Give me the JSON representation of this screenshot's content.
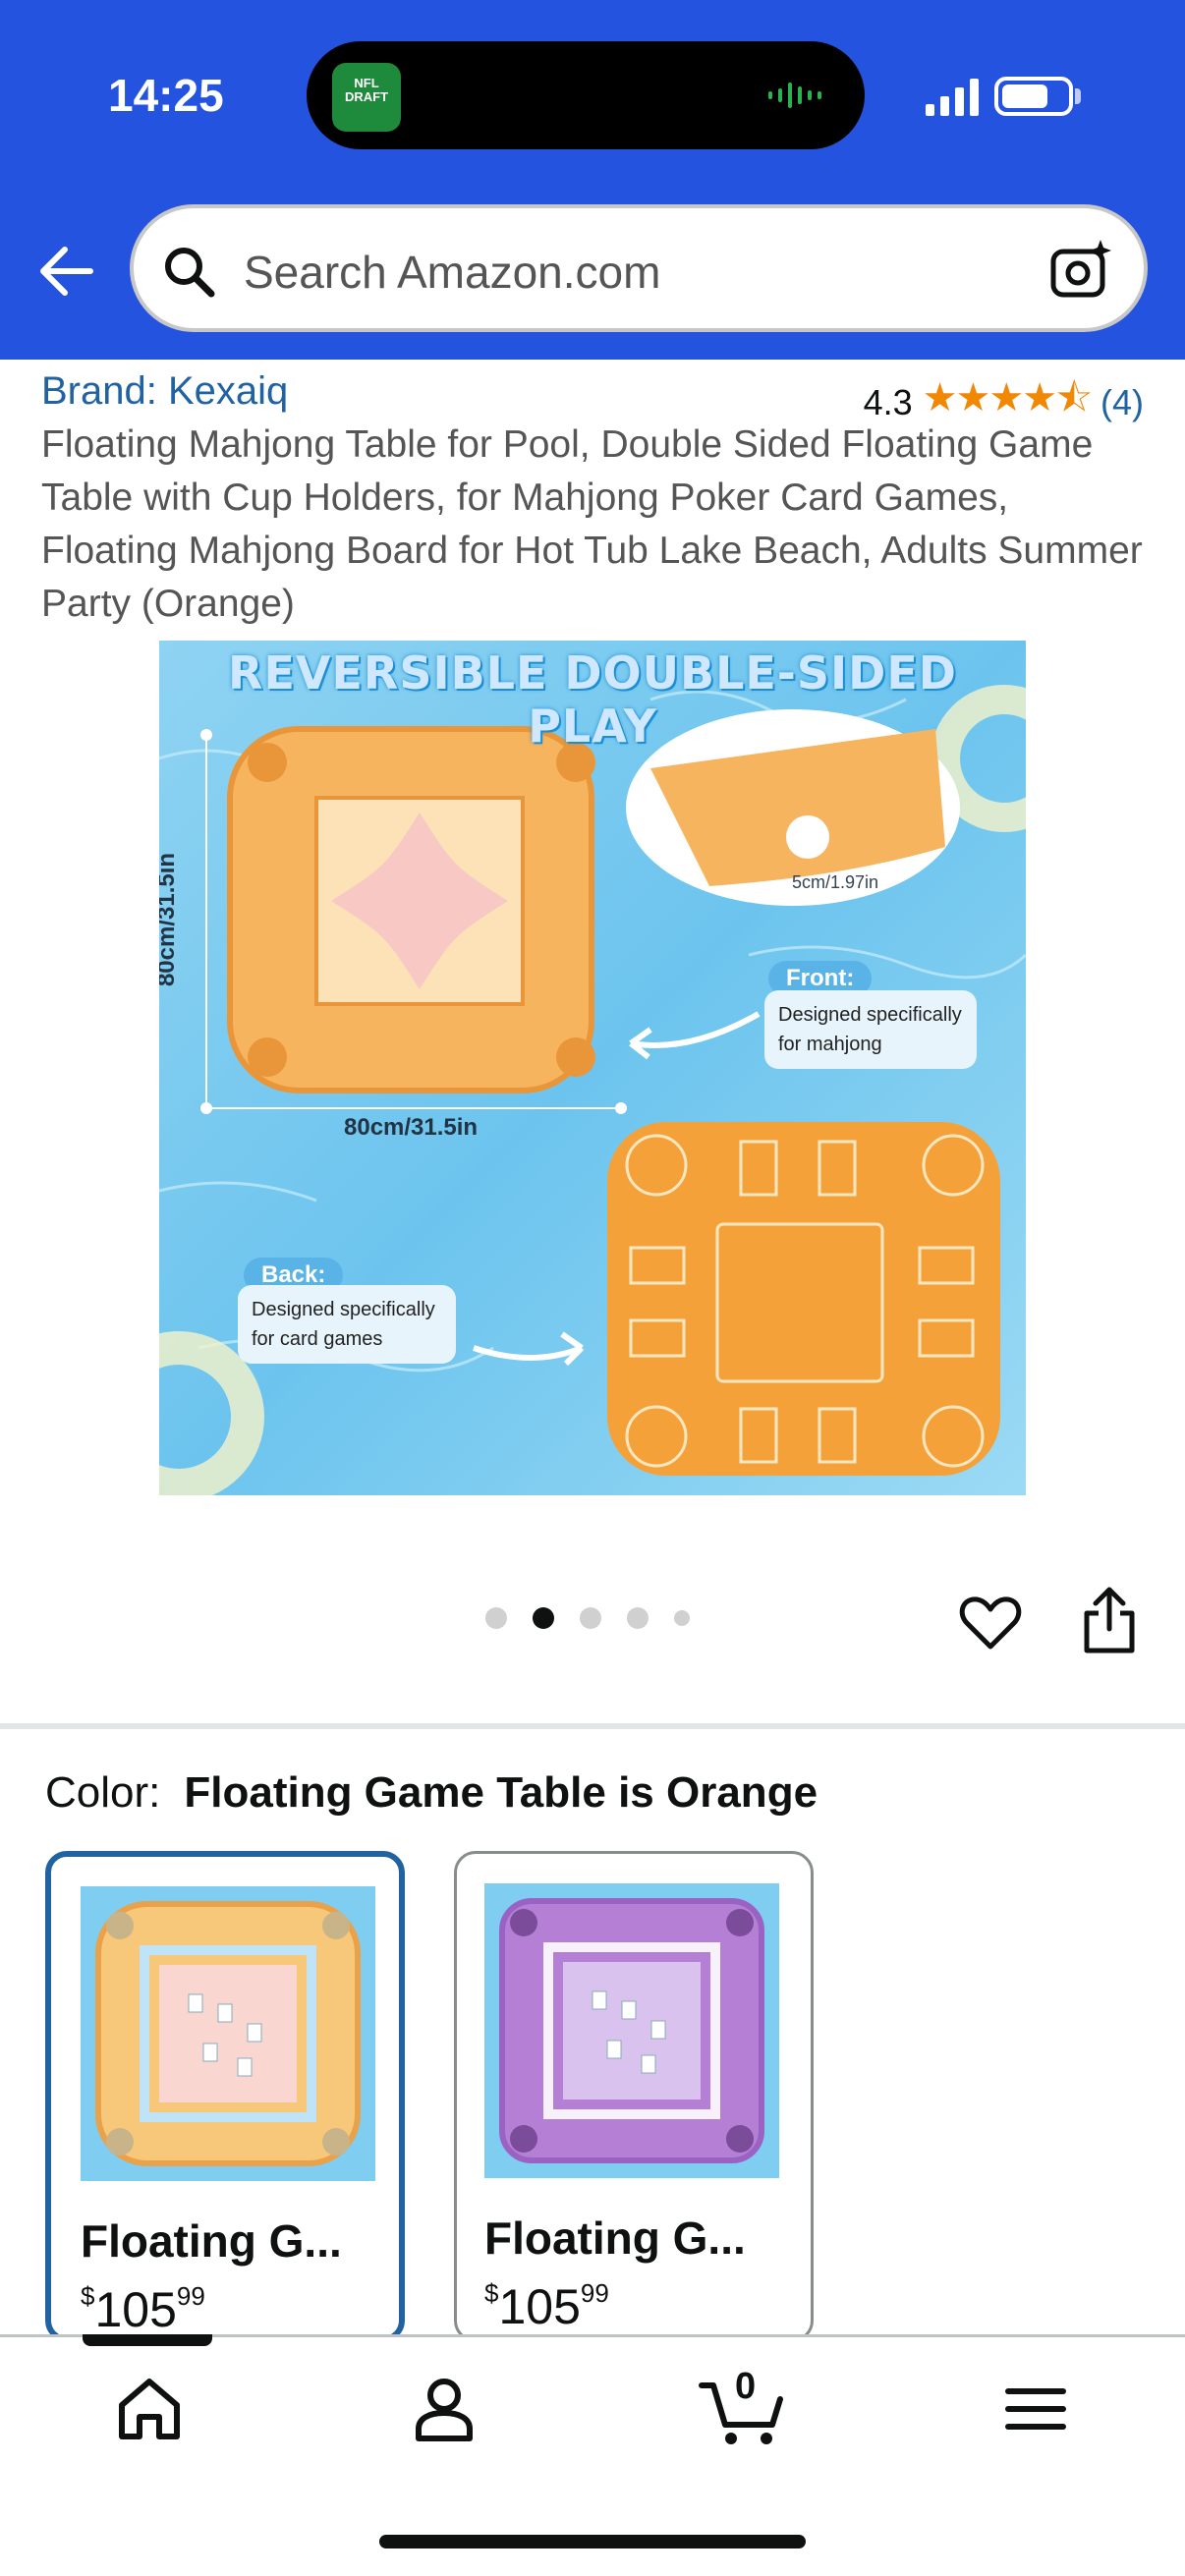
{
  "status_bar": {
    "time": "14:25",
    "island_badge": "NFL DRAFT"
  },
  "search": {
    "placeholder": "Search Amazon.com"
  },
  "product": {
    "brand": "Brand: Kexaiq",
    "rating_value": "4.3",
    "rating_stars": 4.3,
    "rating_count": "(4)",
    "title": "Floating Mahjong Table for Pool, Double Sided Floating Game Table with Cup Holders, for Mahjong Poker Card Games, Floating Mahjong Board for Hot Tub Lake Beach, Adults Summer Party (Orange)"
  },
  "image": {
    "banner": "REVERSIBLE DOUBLE-SIDED PLAY",
    "height_label": "80cm/31.5in",
    "width_label": "80cm/31.5in",
    "depth_label": "5cm/1.97in",
    "front_tag": "Front:",
    "front_text": "Designed specifically for mahjong",
    "back_tag": "Back:",
    "back_text": "Designed specifically for card games"
  },
  "gallery": {
    "total": 5,
    "active_index": 1
  },
  "color": {
    "label": "Color:",
    "value": "Floating Game Table is Orange"
  },
  "swatches": [
    {
      "name": "Floating G...",
      "price_symbol": "$",
      "price_whole": "105",
      "price_fraction": "99",
      "selected": true
    },
    {
      "name": "Floating G...",
      "price_symbol": "$",
      "price_whole": "105",
      "price_fraction": "99",
      "selected": false
    }
  ],
  "bottom_nav": {
    "cart_count": "0",
    "items": [
      "home-icon",
      "account-icon",
      "cart-icon",
      "menu-icon"
    ]
  },
  "colors": {
    "header_bg": "#2453e0",
    "link": "#2162a1",
    "star": "#f08804",
    "table_orange": "#f5a13a"
  }
}
